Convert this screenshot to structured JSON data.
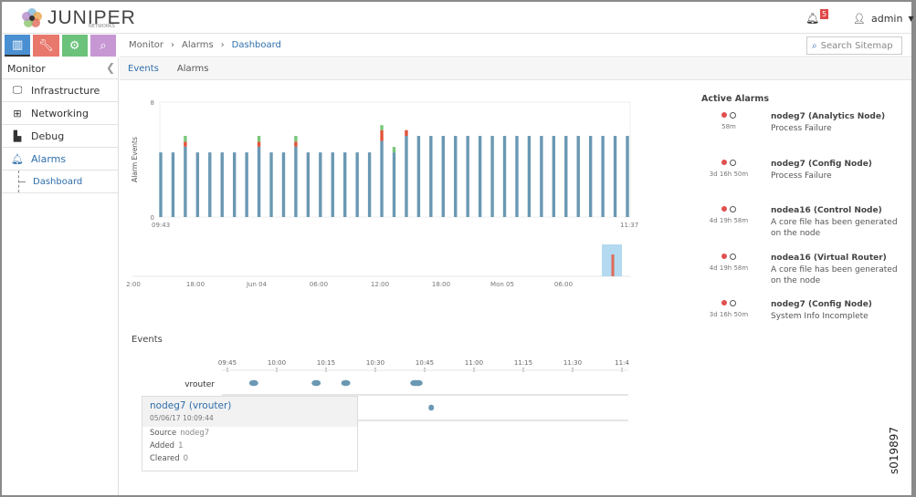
{
  "header": {
    "brand": "JUNIPER",
    "brand_sub": "NETWORKS",
    "notifications": "5",
    "user": "admin"
  },
  "iconbar": [
    {
      "icon": "bar-chart-icon",
      "color": "#4a8fd1"
    },
    {
      "icon": "wrench-icon",
      "color": "#e8776c"
    },
    {
      "icon": "gear-icon",
      "color": "#6bc27a"
    },
    {
      "icon": "search-icon",
      "color": "#c797d4"
    }
  ],
  "sidebar": {
    "title": "Monitor",
    "items": [
      {
        "label": "Infrastructure",
        "icon": "monitor-icon"
      },
      {
        "label": "Networking",
        "icon": "network-icon"
      },
      {
        "label": "Debug",
        "icon": "puzzle-icon"
      },
      {
        "label": "Alarms",
        "icon": "bell-icon"
      }
    ],
    "sub": "Dashboard"
  },
  "breadcrumb": [
    "Monitor",
    "Alarms",
    "Dashboard"
  ],
  "search": {
    "placeholder": "Search Sitemap"
  },
  "tabs": [
    "Events",
    "Alarms"
  ],
  "chart_data": [
    {
      "type": "bar",
      "stacked": true,
      "ylabel": "Alarm Events",
      "ylim": [
        0,
        8
      ],
      "yticks": [
        "0",
        "8"
      ],
      "xticks": [
        "09:43",
        "11:37"
      ],
      "colors": [
        "#6a98b3",
        "#e0533a",
        "#7ac77a"
      ],
      "series": [
        {
          "values": [
            4.5,
            4.5,
            4.9,
            4.5,
            4.5,
            4.5,
            4.5,
            4.5,
            4.9,
            4.5,
            4.5,
            4.9,
            4.5,
            4.5,
            4.5,
            4.5,
            4.5,
            4.5,
            5.3,
            4.5,
            5.65,
            5.65,
            5.65,
            5.65,
            5.65,
            5.65,
            5.65,
            5.65,
            5.65,
            5.65,
            5.65,
            5.65,
            5.65,
            5.65,
            5.65,
            5.65,
            5.65,
            5.65,
            5.65
          ]
        },
        {
          "values": [
            0,
            0,
            0.35,
            0,
            0,
            0,
            0,
            0,
            0.35,
            0,
            0,
            0.35,
            0,
            0,
            0,
            0,
            0,
            0,
            0.75,
            0,
            0.4,
            0,
            0,
            0,
            0,
            0,
            0,
            0,
            0,
            0,
            0,
            0,
            0,
            0,
            0,
            0,
            0,
            0,
            0
          ]
        },
        {
          "values": [
            0,
            0,
            0.4,
            0,
            0,
            0,
            0,
            0,
            0.4,
            0,
            0,
            0.4,
            0,
            0,
            0,
            0,
            0,
            0,
            0.35,
            0.38,
            0,
            0,
            0,
            0,
            0,
            0,
            0,
            0,
            0,
            0,
            0,
            0,
            0,
            0,
            0,
            0,
            0,
            0,
            0
          ]
        }
      ]
    },
    {
      "type": "bar",
      "role": "navigator",
      "xticks": [
        "2:00",
        "18:00",
        "Jun 04",
        "06:00",
        "12:00",
        "18:00",
        "Mon 05",
        "06:00"
      ]
    }
  ],
  "events": {
    "title": "Events",
    "axis": [
      "09:45",
      "10:00",
      "10:15",
      "10:30",
      "10:45",
      "11:00",
      "11:15",
      "11:30",
      "11:4"
    ],
    "row": "vrouter",
    "dots_minutes_after_0945": [
      8,
      27,
      36,
      57,
      58,
      62
    ]
  },
  "tooltip": {
    "title": "nodeg7 (vrouter)",
    "time": "05/06/17 10:09:44",
    "source_label": "Source",
    "source": "nodeg7",
    "added_label": "Added",
    "added": "1",
    "cleared_label": "Cleared",
    "cleared": "0"
  },
  "alarms": {
    "title": "Active Alarms",
    "items": [
      {
        "age": "58m",
        "name": "nodeg7 (Analytics Node)",
        "desc": "Process Failure"
      },
      {
        "age": "3d 16h 50m",
        "name": "nodeg7 (Config Node)",
        "desc": "Process Failure"
      },
      {
        "age": "4d 19h 58m",
        "name": "nodea16 (Control Node)",
        "desc": "A core file has been generated on the node"
      },
      {
        "age": "4d 19h 58m",
        "name": "nodea16 (Virtual Router)",
        "desc": "A core file has been generated on the node"
      },
      {
        "age": "3d 16h 50m",
        "name": "nodeg7 (Config Node)",
        "desc": "System Info Incomplete"
      }
    ]
  },
  "figure_id": "s019897"
}
